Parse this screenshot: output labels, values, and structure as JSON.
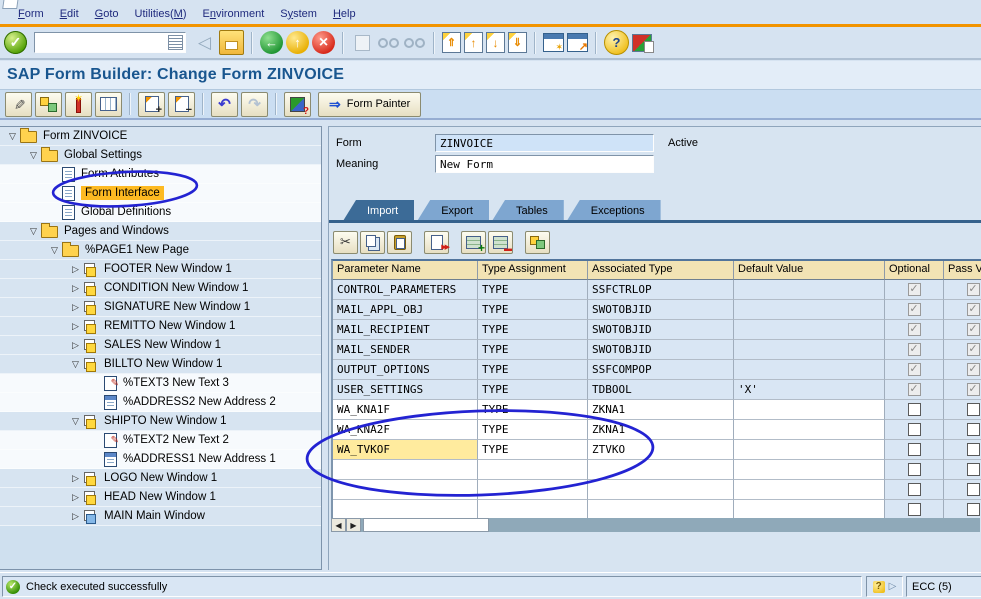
{
  "window": {
    "corner_icon": "window-corner-icon"
  },
  "menu_bar": {
    "items": [
      {
        "label": "Form",
        "accel": 0
      },
      {
        "label": "Edit",
        "accel": 0
      },
      {
        "label": "Goto",
        "accel": 0
      },
      {
        "label": "Utilities(M)",
        "accel": 10
      },
      {
        "label": "Environment",
        "accel": 1
      },
      {
        "label": "System",
        "accel": 1
      },
      {
        "label": "Help",
        "accel": 0
      }
    ]
  },
  "standard_toolbar": {
    "command_value": "",
    "groups": [
      [
        "enter-icon"
      ],
      [
        "command-field"
      ],
      [
        "back-icon",
        "save-icon"
      ],
      [
        "nav-back-icon",
        "nav-exit-icon",
        "cancel-icon"
      ],
      [
        "print-icon",
        "find-icon",
        "find-next-icon"
      ],
      [
        "first-page-icon",
        "previous-page-icon",
        "next-page-icon",
        "last-page-icon"
      ],
      [
        "new-session-icon",
        "create-shortcut-icon"
      ],
      [
        "help-icon",
        "customize-layout-icon"
      ]
    ]
  },
  "title_bar": {
    "title": "SAP Form Builder: Change Form ZINVOICE"
  },
  "app_toolbar": {
    "icon_groups": [
      [
        "toggle-display-change-icon",
        "structure-icon",
        "check-icon",
        "table-settings-icon"
      ],
      [
        "expand-node-icon",
        "collapse-node-icon"
      ],
      [
        "undo-icon",
        "redo-icon"
      ],
      [
        "graphic-settings-icon"
      ]
    ],
    "form_painter_button": {
      "icon": "right-arrow-icon",
      "label": "Form Painter"
    }
  },
  "tree": {
    "items": [
      {
        "label": "Form ZINVOICE",
        "level": 0,
        "icon": "folder-icon",
        "expander": "expanded",
        "row": "blue"
      },
      {
        "label": "Global Settings",
        "level": 1,
        "icon": "folder-icon",
        "expander": "expanded",
        "row": "blue"
      },
      {
        "label": "Form Attributes",
        "level": 2,
        "icon": "document-icon",
        "expander": null,
        "row": "white"
      },
      {
        "label": "Form Interface",
        "level": 2,
        "icon": "document-icon",
        "expander": null,
        "row": "white",
        "highlighted": true
      },
      {
        "label": "Global Definitions",
        "level": 2,
        "icon": "document-icon",
        "expander": null,
        "row": "white"
      },
      {
        "label": "Pages and Windows",
        "level": 1,
        "icon": "folder-icon",
        "expander": "expanded",
        "row": "blue"
      },
      {
        "label": "%PAGE1 New Page",
        "level": 2,
        "icon": "folder-icon",
        "expander": "expanded",
        "row": "blue"
      },
      {
        "label": "FOOTER New Window 1",
        "level": 3,
        "icon": "window-icon",
        "expander": "collapsed",
        "row": "blue"
      },
      {
        "label": "CONDITION New Window 1",
        "level": 3,
        "icon": "window-icon",
        "expander": "collapsed",
        "row": "blue"
      },
      {
        "label": "SIGNATURE New Window 1",
        "level": 3,
        "icon": "window-icon",
        "expander": "collapsed",
        "row": "blue"
      },
      {
        "label": "REMITTO New Window 1",
        "level": 3,
        "icon": "window-icon",
        "expander": "collapsed",
        "row": "blue"
      },
      {
        "label": "SALES New Window 1",
        "level": 3,
        "icon": "window-icon",
        "expander": "collapsed",
        "row": "blue"
      },
      {
        "label": "BILLTO New Window 1",
        "level": 3,
        "icon": "window-icon",
        "expander": "expanded",
        "row": "blue"
      },
      {
        "label": "%TEXT3 New Text 3",
        "level": 4,
        "icon": "text-icon",
        "expander": null,
        "row": "white"
      },
      {
        "label": "%ADDRESS2 New Address 2",
        "level": 4,
        "icon": "address-icon",
        "expander": null,
        "row": "white"
      },
      {
        "label": "SHIPTO New Window 1",
        "level": 3,
        "icon": "window-icon",
        "expander": "expanded",
        "row": "blue"
      },
      {
        "label": "%TEXT2 New Text 2",
        "level": 4,
        "icon": "text-icon",
        "expander": null,
        "row": "white"
      },
      {
        "label": "%ADDRESS1 New Address 1",
        "level": 4,
        "icon": "address-icon",
        "expander": null,
        "row": "white"
      },
      {
        "label": "LOGO New Window 1",
        "level": 3,
        "icon": "window-icon",
        "expander": "collapsed",
        "row": "blue"
      },
      {
        "label": "HEAD New Window 1",
        "level": 3,
        "icon": "window-icon",
        "expander": "collapsed",
        "row": "blue"
      },
      {
        "label": "MAIN Main Window",
        "level": 3,
        "icon": "main-window-icon",
        "expander": "collapsed",
        "row": "blue"
      }
    ]
  },
  "detail": {
    "form_label": "Form",
    "form_value": "ZINVOICE",
    "active_label": "Active",
    "meaning_label": "Meaning",
    "meaning_value": "New Form",
    "tabs": [
      {
        "label": "Import",
        "active": true
      },
      {
        "label": "Export",
        "active": false
      },
      {
        "label": "Tables",
        "active": false
      },
      {
        "label": "Exceptions",
        "active": false
      }
    ],
    "table_toolbar_icons": [
      "cut-icon",
      "copy-icon",
      "paste-icon",
      "append-rows-icon",
      "insert-row-icon",
      "delete-row-icon",
      "hierarchy-icon"
    ],
    "table": {
      "columns": [
        "Parameter Name",
        "Type Assignment",
        "Associated Type",
        "Default Value",
        "Optional",
        "Pass V"
      ],
      "rows": [
        {
          "parameter": "CONTROL_PARAMETERS",
          "type": "TYPE",
          "associated": "SSFCTRLOP",
          "default": "",
          "optional": true,
          "pass": true,
          "protected": true,
          "selected": false
        },
        {
          "parameter": "MAIL_APPL_OBJ",
          "type": "TYPE",
          "associated": "SWOTOBJID",
          "default": "",
          "optional": true,
          "pass": true,
          "protected": true,
          "selected": false
        },
        {
          "parameter": "MAIL_RECIPIENT",
          "type": "TYPE",
          "associated": "SWOTOBJID",
          "default": "",
          "optional": true,
          "pass": true,
          "protected": true,
          "selected": false
        },
        {
          "parameter": "MAIL_SENDER",
          "type": "TYPE",
          "associated": "SWOTOBJID",
          "default": "",
          "optional": true,
          "pass": true,
          "protected": true,
          "selected": false
        },
        {
          "parameter": "OUTPUT_OPTIONS",
          "type": "TYPE",
          "associated": "SSFCOMPOP",
          "default": "",
          "optional": true,
          "pass": true,
          "protected": true,
          "selected": false
        },
        {
          "parameter": "USER_SETTINGS",
          "type": "TYPE",
          "associated": "TDBOOL",
          "default": "'X'",
          "optional": true,
          "pass": true,
          "protected": true,
          "selected": false
        },
        {
          "parameter": "WA_KNA1F",
          "type": "TYPE",
          "associated": "ZKNA1",
          "default": "",
          "optional": false,
          "pass": false,
          "protected": false,
          "selected": false
        },
        {
          "parameter": "WA_KNA2F",
          "type": "TYPE",
          "associated": "ZKNA1",
          "default": "",
          "optional": false,
          "pass": false,
          "protected": false,
          "selected": false
        },
        {
          "parameter": "WA_TVKOF",
          "type": "TYPE",
          "associated": "ZTVKO",
          "default": "",
          "optional": false,
          "pass": false,
          "protected": false,
          "selected": true
        },
        {
          "parameter": "",
          "type": "",
          "associated": "",
          "default": "",
          "optional": false,
          "pass": false,
          "protected": false,
          "selected": false
        },
        {
          "parameter": "",
          "type": "",
          "associated": "",
          "default": "",
          "optional": false,
          "pass": false,
          "protected": false,
          "selected": false
        },
        {
          "parameter": "",
          "type": "",
          "associated": "",
          "default": "",
          "optional": false,
          "pass": false,
          "protected": false,
          "selected": false
        }
      ]
    }
  },
  "annotations": {
    "circle_color": "#2323d2"
  },
  "status_bar": {
    "icon": "success-icon",
    "message": "Check executed successfully",
    "help_icon": "help-question-icon",
    "expand_icon": "play-icon",
    "system_text": "ECC (5)"
  }
}
